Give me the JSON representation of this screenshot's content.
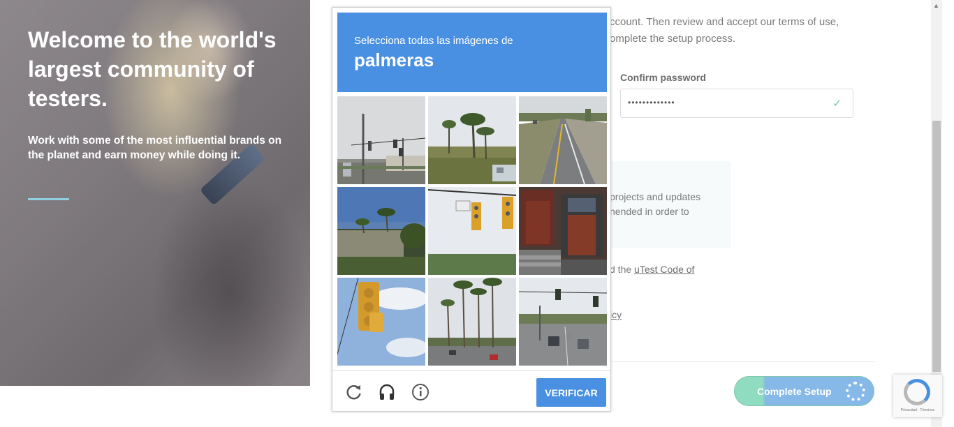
{
  "hero": {
    "title": "Welcome to the world's largest community of testers.",
    "subtitle": "Work with some of the most influential brands on the planet and earn money while doing it."
  },
  "form": {
    "intro_text": "ccount. Then review and accept our terms of use, omplete the setup process.",
    "confirm_password_label": "Confirm password",
    "confirm_password_value": "•••••••••••••",
    "info_text": "projects and updates nended in order to",
    "code_text_prefix": "d the ",
    "code_link": "uTest Code of",
    "policy_fragment": "icy",
    "complete_button": "Complete Setup"
  },
  "captcha": {
    "instruction": "Selecciona todas las imágenes de",
    "object": "palmeras",
    "verify_button": "VERIFICAR",
    "tiles": [
      "tile-1",
      "tile-2",
      "tile-3",
      "tile-4",
      "tile-5",
      "tile-6",
      "tile-7",
      "tile-8",
      "tile-9"
    ]
  },
  "recaptcha_badge": {
    "terms": "Privacidad - Términos"
  },
  "icons": {
    "reload": "reload-icon",
    "audio": "headphones-icon",
    "info": "info-icon",
    "check": "check-icon"
  },
  "colors": {
    "captcha_blue": "#4a90e2",
    "hero_accent": "#8fcfe0",
    "button_gradient_start": "#8fdcc0",
    "button_gradient_end": "#86b8e8"
  }
}
